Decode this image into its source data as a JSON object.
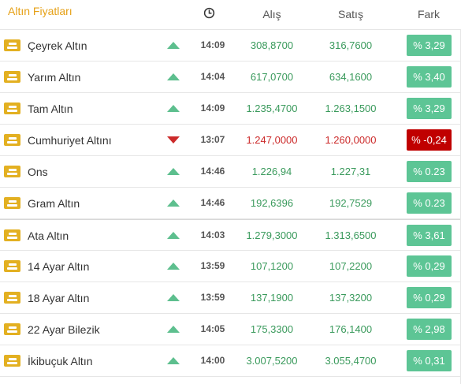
{
  "header": {
    "title": "Altın Fiyatları",
    "clock_icon": "clock-icon",
    "col_alis": "Alış",
    "col_satis": "Satış",
    "col_fark": "Fark"
  },
  "colors": {
    "accent": "#e6a117",
    "up": "#5dc595",
    "down": "#c00000",
    "up_text": "#3a9a5c",
    "down_text": "#cc2a2a"
  },
  "rows": [
    {
      "name": "Çeyrek Altın",
      "trend": "up",
      "time": "14:09",
      "alis": "308,8700",
      "satis": "316,7600",
      "fark": "% 3,29"
    },
    {
      "name": "Yarım Altın",
      "trend": "up",
      "time": "14:04",
      "alis": "617,0700",
      "satis": "634,1600",
      "fark": "% 3,40"
    },
    {
      "name": "Tam Altın",
      "trend": "up",
      "time": "14:09",
      "alis": "1.235,4700",
      "satis": "1.263,1500",
      "fark": "% 3,29"
    },
    {
      "name": "Cumhuriyet Altını",
      "trend": "down",
      "time": "13:07",
      "alis": "1.247,0000",
      "satis": "1.260,0000",
      "fark": "% -0,24"
    },
    {
      "name": "Ons",
      "trend": "up",
      "time": "14:46",
      "alis": "1.226,94",
      "satis": "1.227,31",
      "fark": "% 0.23"
    },
    {
      "name": "Gram Altın",
      "trend": "up",
      "time": "14:46",
      "alis": "192,6396",
      "satis": "192,7529",
      "fark": "% 0.23"
    },
    {
      "name": "Ata Altın",
      "trend": "up",
      "time": "14:03",
      "alis": "1.279,3000",
      "satis": "1.313,6500",
      "fark": "% 3,61"
    },
    {
      "name": "14 Ayar Altın",
      "trend": "up",
      "time": "13:59",
      "alis": "107,1200",
      "satis": "107,2200",
      "fark": "% 0,29"
    },
    {
      "name": "18 Ayar Altın",
      "trend": "up",
      "time": "13:59",
      "alis": "137,1900",
      "satis": "137,3200",
      "fark": "% 0,29"
    },
    {
      "name": "22 Ayar Bilezik",
      "trend": "up",
      "time": "14:05",
      "alis": "175,3300",
      "satis": "176,1400",
      "fark": "% 2,98"
    },
    {
      "name": "İkibuçuk Altın",
      "trend": "up",
      "time": "14:00",
      "alis": "3.007,5200",
      "satis": "3.055,4700",
      "fark": "% 0,31"
    }
  ]
}
